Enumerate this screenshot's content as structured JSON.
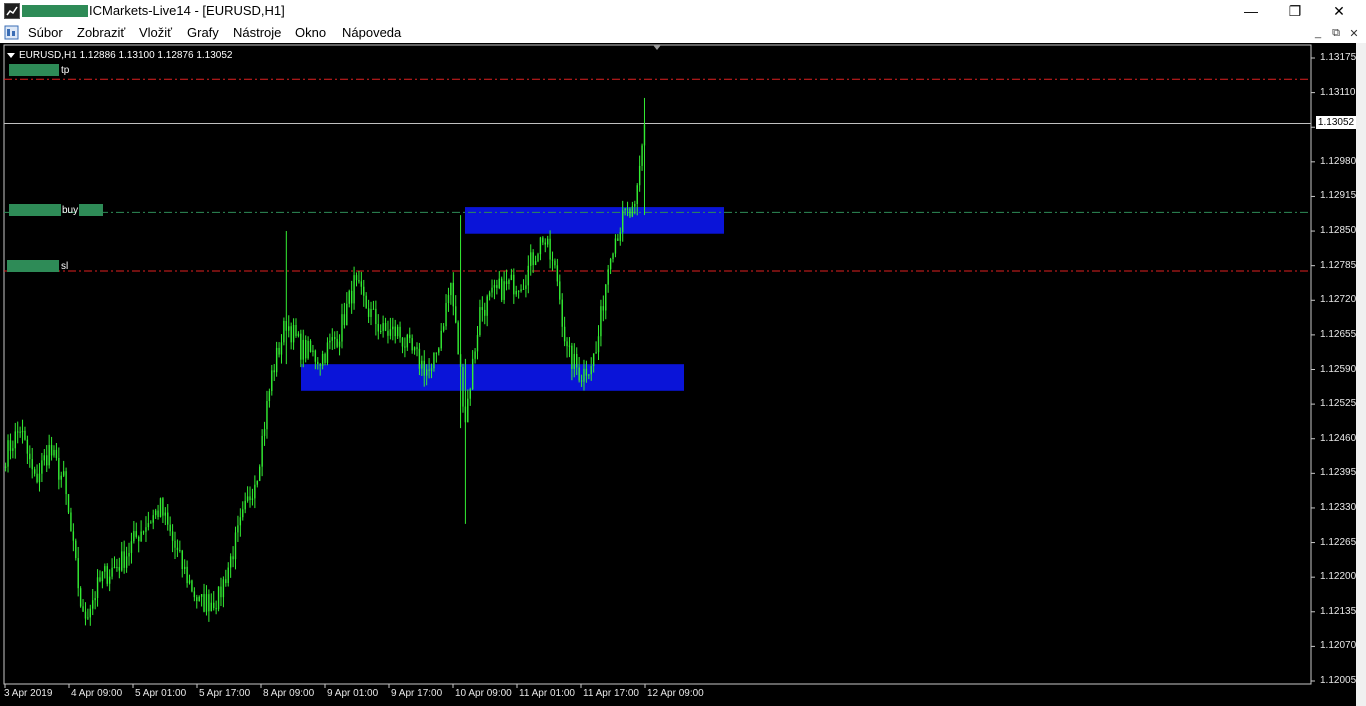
{
  "window": {
    "title": "ICMarkets-Live14 - [EURUSD,H1]",
    "minimize_glyph": "—",
    "restore_glyph": "❐",
    "close_glyph": "✕"
  },
  "menu": {
    "items": [
      {
        "label": "Súbor"
      },
      {
        "label": "Zobraziť"
      },
      {
        "label": "Vložiť"
      },
      {
        "label": "Grafy"
      },
      {
        "label": "Nástroje"
      },
      {
        "label": "Okno"
      },
      {
        "label": "Nápoveda"
      }
    ],
    "mdi_minimize": "_",
    "mdi_restore": "⧉",
    "mdi_close": "✕"
  },
  "chart": {
    "info": "EURUSD,H1  1.12886 1.13100 1.12876 1.13052",
    "current_price": "1.13052",
    "colors": {
      "background": "#000000",
      "candle": "#33ee33",
      "zone": "#0a14d8",
      "tp_sl_line": "#e02020",
      "buy_line": "#2e8b57",
      "price_line": "#c0c0c0"
    },
    "lines": {
      "tp": {
        "label": "tp",
        "price": 1.13135
      },
      "buy": {
        "label": "buy",
        "price": 1.12885
      },
      "sl": {
        "label": "sl",
        "price": 1.12775
      }
    },
    "zones": [
      {
        "from_price": 1.12895,
        "to_price": 1.12845,
        "from_time": "10 Apr 09:00",
        "to_time": "12 Apr 23:00"
      },
      {
        "from_price": 1.126,
        "to_price": 1.1255,
        "from_time": "8 Apr 18:00",
        "to_time": "12 Apr 17:00"
      }
    ]
  },
  "chart_data": {
    "type": "candlestick",
    "symbol": "EURUSD",
    "timeframe": "H1",
    "y_ticks": [
      "1.13175",
      "1.13110",
      "1.13045",
      "1.12980",
      "1.12915",
      "1.12850",
      "1.12785",
      "1.12720",
      "1.12655",
      "1.12590",
      "1.12525",
      "1.12460",
      "1.12395",
      "1.12330",
      "1.12265",
      "1.12200",
      "1.12135",
      "1.12070",
      "1.12005"
    ],
    "x_ticks": [
      "3 Apr 2019",
      "4 Apr 09:00",
      "5 Apr 01:00",
      "5 Apr 17:00",
      "8 Apr 09:00",
      "9 Apr 01:00",
      "9 Apr 17:00",
      "10 Apr 09:00",
      "11 Apr 01:00",
      "11 Apr 17:00",
      "12 Apr 09:00"
    ],
    "ylim": [
      1.12005,
      1.13175
    ],
    "anchor_closes": [
      [
        0,
        1.1243
      ],
      [
        6,
        1.1248
      ],
      [
        12,
        1.1238
      ],
      [
        18,
        1.1244
      ],
      [
        24,
        1.1238
      ],
      [
        32,
        1.1212
      ],
      [
        40,
        1.122
      ],
      [
        48,
        1.1223
      ],
      [
        56,
        1.1229
      ],
      [
        64,
        1.1233
      ],
      [
        72,
        1.1223
      ],
      [
        80,
        1.1215
      ],
      [
        88,
        1.1216
      ],
      [
        96,
        1.1228
      ],
      [
        104,
        1.124
      ],
      [
        110,
        1.1258
      ],
      [
        116,
        1.1268
      ],
      [
        122,
        1.1263
      ],
      [
        130,
        1.1261
      ],
      [
        138,
        1.1266
      ],
      [
        144,
        1.1275
      ],
      [
        150,
        1.127
      ],
      [
        156,
        1.1266
      ],
      [
        162,
        1.1266
      ],
      [
        168,
        1.1262
      ],
      [
        176,
        1.1258
      ],
      [
        184,
        1.1275
      ],
      [
        190,
        1.125
      ],
      [
        196,
        1.127
      ],
      [
        204,
        1.1274
      ],
      [
        214,
        1.1276
      ],
      [
        222,
        1.1284
      ],
      [
        228,
        1.1276
      ],
      [
        232,
        1.1262
      ],
      [
        238,
        1.1258
      ],
      [
        244,
        1.1262
      ],
      [
        250,
        1.1282
      ],
      [
        256,
        1.1288
      ],
      [
        260,
        1.1288
      ],
      [
        264,
        1.1305
      ]
    ],
    "wicks": [
      [
        116,
        1.1285,
        1.126
      ],
      [
        190,
        1.1261,
        1.123
      ],
      [
        188,
        1.1288,
        1.1248
      ],
      [
        264,
        1.131,
        1.1288
      ]
    ]
  }
}
